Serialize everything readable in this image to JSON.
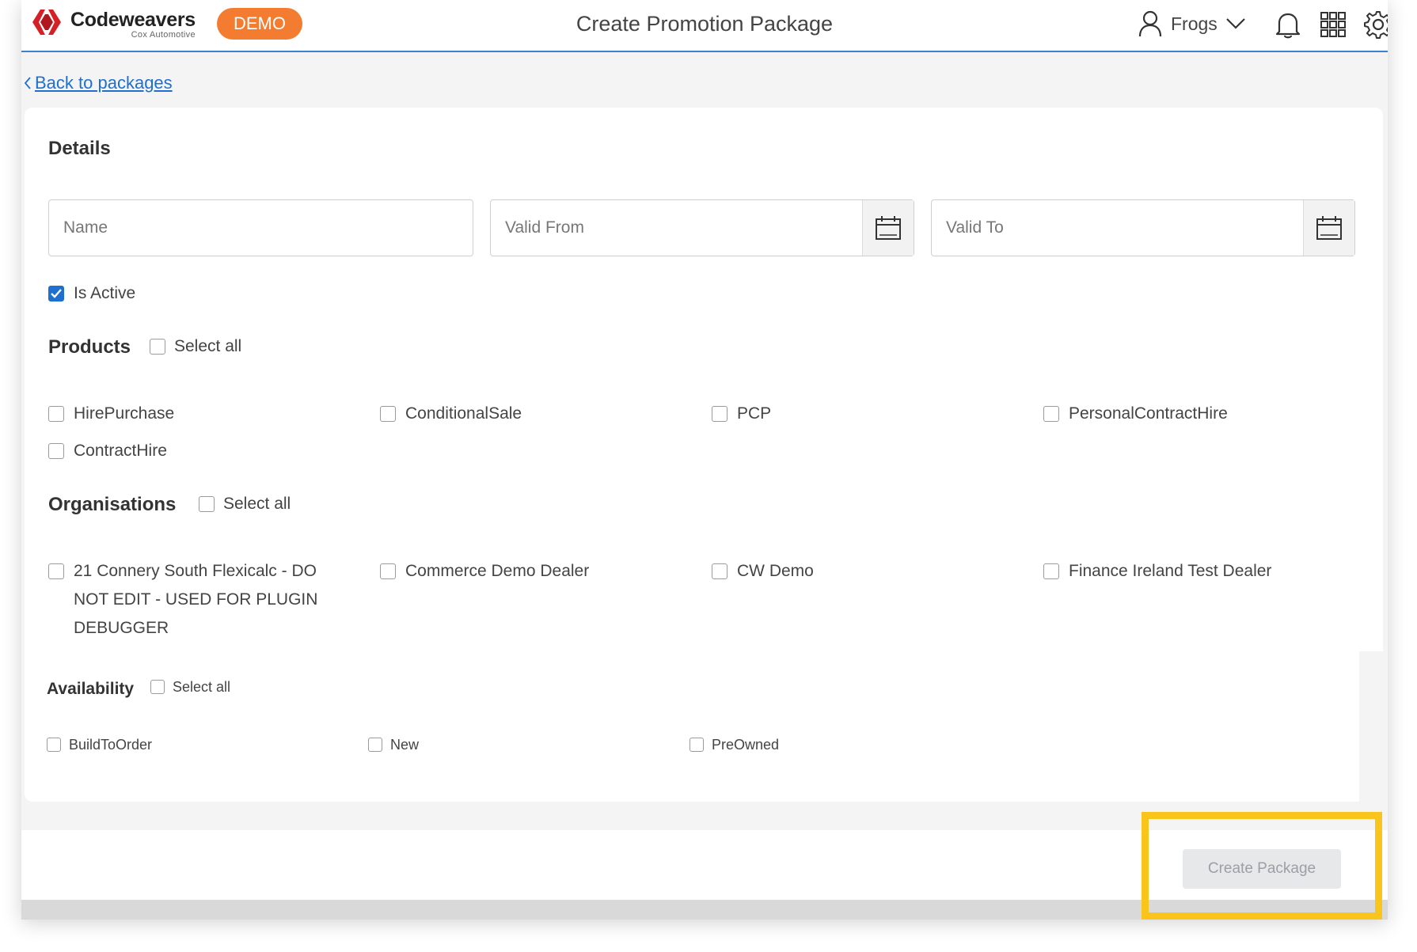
{
  "brand": {
    "name": "Codeweavers",
    "sub": "Cox Automotive",
    "badge": "DEMO"
  },
  "header": {
    "title": "Create Promotion Package",
    "user": "Frogs"
  },
  "nav": {
    "back": "Back to packages"
  },
  "details": {
    "title": "Details",
    "name_placeholder": "Name",
    "valid_from_placeholder": "Valid From",
    "valid_to_placeholder": "Valid To",
    "is_active_label": "Is Active",
    "is_active": true
  },
  "products": {
    "title": "Products",
    "select_all": "Select all",
    "items": [
      "HirePurchase",
      "ConditionalSale",
      "PCP",
      "PersonalContractHire",
      "ContractHire"
    ]
  },
  "organisations": {
    "title": "Organisations",
    "select_all": "Select all",
    "items": [
      "21 Connery South Flexicalc - DO NOT EDIT - USED FOR PLUGIN DEBUGGER",
      "Commerce Demo Dealer",
      "CW Demo",
      "Finance Ireland Test Dealer"
    ]
  },
  "availability": {
    "title": "Availability",
    "select_all": "Select all",
    "items": [
      "BuildToOrder",
      "New",
      "PreOwned"
    ]
  },
  "footer": {
    "create_button": "Create Package"
  },
  "colors": {
    "accent": "#1f6fd0",
    "badge": "#f47c30",
    "highlight": "#f9c41c"
  }
}
